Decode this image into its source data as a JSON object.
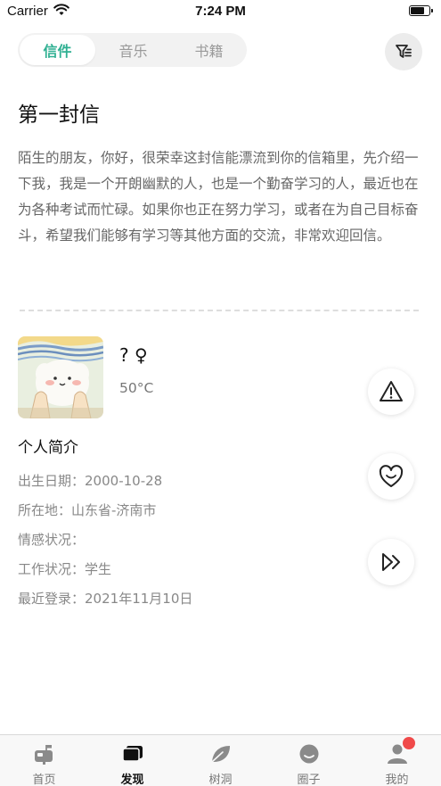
{
  "status_bar": {
    "carrier": "Carrier",
    "time": "7:24 PM",
    "battery_level": 0.7
  },
  "tabs": [
    {
      "label": "信件",
      "active": true
    },
    {
      "label": "音乐",
      "active": false
    },
    {
      "label": "书籍",
      "active": false
    }
  ],
  "letter": {
    "title": "第一封信",
    "body": "陌生的朋友，你好，很荣幸这封信能漂流到你的信箱里，先介绍一下我，我是一个开朗幽默的人，也是一个勤奋学习的人，最近也在为各种考试而忙碌。如果你也正在努力学习，或者在为自己目标奋斗，希望我们能够有学习等其他方面的交流，非常欢迎回信。"
  },
  "user": {
    "name": "? ♀",
    "temperature": "50°C"
  },
  "profile": {
    "title": "个人简介",
    "rows": [
      {
        "label": "出生日期：",
        "value": "2000-10-28"
      },
      {
        "label": "所在地：",
        "value": "山东省-济南市"
      },
      {
        "label": "情感状况：",
        "value": ""
      },
      {
        "label": "工作状况：",
        "value": "学生"
      },
      {
        "label": "最近登录：",
        "value": "2021年11月10日"
      }
    ]
  },
  "actions": {
    "report_icon": "warning-icon",
    "like_icon": "heart-icon",
    "next_icon": "fast-forward-icon"
  },
  "bottom_nav": [
    {
      "label": "首页",
      "icon": "mailbox-icon",
      "active": false
    },
    {
      "label": "发现",
      "icon": "cards-icon",
      "active": true
    },
    {
      "label": "树洞",
      "icon": "leaf-icon",
      "active": false
    },
    {
      "label": "圈子",
      "icon": "smile-icon",
      "active": false
    },
    {
      "label": "我的",
      "icon": "person-icon",
      "active": false,
      "badge": true
    }
  ],
  "colors": {
    "accent": "#2fb092",
    "badge": "#f04a4a",
    "nav_icon": "#8a8a8a",
    "nav_icon_active": "#111111"
  }
}
